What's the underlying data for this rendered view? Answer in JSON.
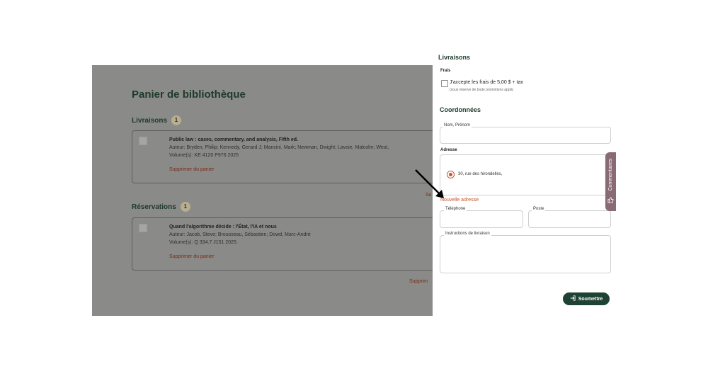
{
  "background": {
    "title": "Panier de bibliothèque",
    "livraisons": {
      "label": "Livraisons",
      "count": "1",
      "item": {
        "title": "Public law : cases, commentary, and analysis, Fifth ed.",
        "author": "Auteur: Bryden, Philip; Kennedy, Gerard J; Mancini, Mark; Newman, Dwight; Lavoie, Malcolm; West,",
        "volume": "Volume(s):  KE 4120 P976 2025",
        "remove": "Supprimer du panier"
      },
      "submit_clip": "Su"
    },
    "reservations": {
      "label": "Réservations",
      "count": "1",
      "item": {
        "title": "Quand l'algorithme décide : l'État, l'IA et nous",
        "author": "Auteur: Jacob, Steve; Brousseau, Sébastien; Dowd, Marc-André",
        "volume": "Volume(s):  Q 334.7 J151 2025",
        "remove": "Supprimer du panier"
      },
      "submit_clip": "Supprim"
    }
  },
  "panel": {
    "heading": "Livraisons",
    "frais": {
      "label": "Frais",
      "accept": "J'accepte les frais de 5,00 $ + tax",
      "note": "(sous réserve de toute promotions applic",
      "checked": false
    },
    "coordonnees": {
      "heading": "Coordonnées",
      "name_label": "Nom, Prénom",
      "name_value": "",
      "adresse_label": "Adresse",
      "address_option": "30, rue des hirondelles,",
      "new_address": "Nouvelle adresse",
      "phone_label": "Téléphone",
      "poste_label": "Poste",
      "instructions_label": "Instructions de livraison"
    },
    "submit": "Soumettre"
  },
  "feedback_tab": "Commentaires",
  "colors": {
    "brand_green": "#1e4233",
    "accent_orange": "#c8542a",
    "overlay_gray": "#8a8a88",
    "feedback_tab": "#8a6a74"
  }
}
